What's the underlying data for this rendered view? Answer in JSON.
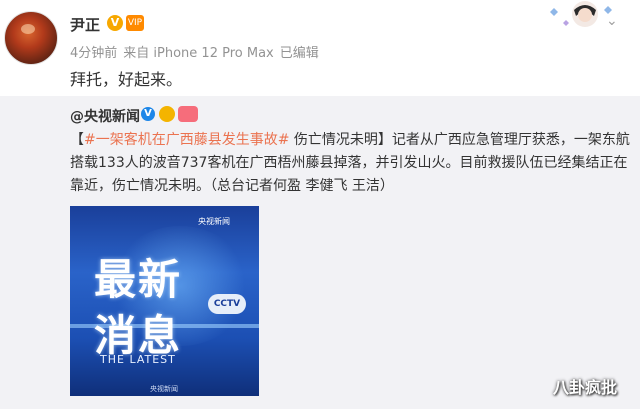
{
  "post": {
    "username": "尹正",
    "v_badge": "V",
    "vip_badge": "VIP",
    "time": "4分钟前",
    "source": "来自 iPhone 12 Pro Max",
    "edited": "已编辑",
    "content": "拜托，好起来。",
    "more_icon": "chevron-down-icon"
  },
  "repost": {
    "username": "@央视新闻",
    "v_badge": "V",
    "text_open": "【",
    "topic": "#一架客机在广西藤县发生事故#",
    "text_rest": " 伤亡情况未明】记者从广西应急管理厅获悉，一架东航搭载133人的波音737客机在广西梧州藤县掉落，并引发山火。目前救援队伍已经集结正在靠近，伤亡情况未明。（总台记者何盈 李健飞 王洁）",
    "image": {
      "headline_line1": "最新",
      "headline_line2": "消息",
      "subtitle": "THE LATEST",
      "logo_top": "央视新闻",
      "cctv_logo": "CCTV"
    }
  },
  "watermark": "八卦疯批",
  "colors": {
    "topic": "#eb7350",
    "repost_bg": "#f2f2f5",
    "meta": "#939393"
  }
}
